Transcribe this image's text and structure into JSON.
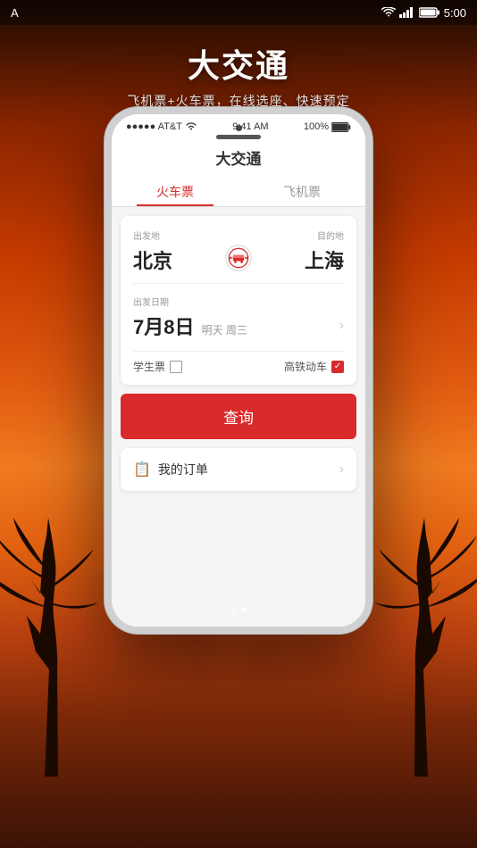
{
  "status_bar": {
    "indicator": "A",
    "wifi": "▲▲▲▲",
    "network": "▲▲",
    "battery_icon": "🔋",
    "time": "5:00"
  },
  "header": {
    "title": "大交通",
    "subtitle": "飞机票+火车票，在线选座、快速预定"
  },
  "phone": {
    "status": {
      "carrier": "●●●●● AT&T",
      "wifi_icon": "wifi",
      "time": "9:41 AM",
      "battery": "100%"
    },
    "app_name": "大交通",
    "tabs": [
      {
        "label": "火车票",
        "active": true
      },
      {
        "label": "飞机票",
        "active": false
      }
    ],
    "search_form": {
      "from_label": "出发地",
      "from_city": "北京",
      "to_label": "目的地",
      "to_city": "上海",
      "date_label": "出发日期",
      "date_value": "7月8日",
      "date_desc": "明天 周三",
      "student_label": "学生票",
      "student_checked": false,
      "highspeed_label": "高铁动车",
      "highspeed_checked": true,
      "search_btn_label": "查询"
    },
    "orders": {
      "icon": "📋",
      "label": "我的订单"
    }
  },
  "page_dots": [
    {
      "active": true
    },
    {
      "active": false
    }
  ]
}
